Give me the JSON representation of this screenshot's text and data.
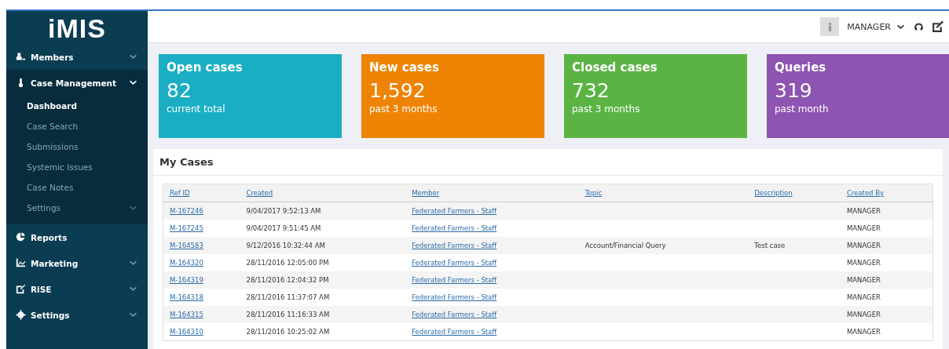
{
  "sidebar": {
    "logo": "iMIS",
    "items": [
      {
        "label": "Members",
        "kind": "group",
        "expanded": false
      },
      {
        "label": "Case Management",
        "kind": "group",
        "expanded": true,
        "children": [
          {
            "label": "Dashboard",
            "kind": "link",
            "selected": true
          },
          {
            "label": "Case Search",
            "kind": "link",
            "selected": false
          },
          {
            "label": "Submissions",
            "kind": "link",
            "selected": false
          },
          {
            "label": "Systemic Issues",
            "kind": "link",
            "selected": false
          },
          {
            "label": "Case Notes",
            "kind": "link",
            "selected": false
          },
          {
            "label": "Settings",
            "kind": "group",
            "selected": false
          }
        ]
      },
      {
        "label": "Reports",
        "kind": "link",
        "expanded": false
      },
      {
        "label": "Marketing",
        "kind": "group",
        "expanded": false
      },
      {
        "label": "RiSE",
        "kind": "group",
        "expanded": false
      },
      {
        "label": "Settings",
        "kind": "group",
        "expanded": false
      }
    ]
  },
  "topbar": {
    "user": "MANAGER"
  },
  "cards": [
    {
      "title": "Open cases",
      "value": "82",
      "note": "current total",
      "color": "#1aaec4"
    },
    {
      "title": "New cases",
      "value": "1,592",
      "note": "past 3 months",
      "color": "#ef8404"
    },
    {
      "title": "Closed cases",
      "value": "732",
      "note": "past 3 months",
      "color": "#5bb344"
    },
    {
      "title": "Queries",
      "value": "319",
      "note": "past month",
      "color": "#8e54b2"
    }
  ],
  "my_cases": {
    "title": "My Cases",
    "columns": [
      "Ref ID",
      "Created",
      "Member",
      "Topic",
      "Description",
      "Created By"
    ],
    "rows": [
      [
        "M-167246",
        "9/04/2017 9:52:13 AM",
        "Federated Farmers - Staff",
        "",
        "",
        "MANAGER"
      ],
      [
        "M-167245",
        "9/04/2017 9:51:45 AM",
        "Federated Farmers - Staff",
        "",
        "",
        "MANAGER"
      ],
      [
        "M-164583",
        "9/12/2016 10:32:44 AM",
        "Federated Farmers - Staff",
        "Account/Financial Query",
        "Test case",
        "MANAGER"
      ],
      [
        "M-164320",
        "28/11/2016 12:05:00 PM",
        "Federated Farmers - Staff",
        "",
        "",
        "MANAGER"
      ],
      [
        "M-164319",
        "28/11/2016 12:04:32 PM",
        "Federated Farmers - Staff",
        "",
        "",
        "MANAGER"
      ],
      [
        "M-164318",
        "28/11/2016 11:37:07 AM",
        "Federated Farmers - Staff",
        "",
        "",
        "MANAGER"
      ],
      [
        "M-164315",
        "28/11/2016 11:16:33 AM",
        "Federated Farmers - Staff",
        "",
        "",
        "MANAGER"
      ],
      [
        "M-164310",
        "28/11/2016 10:25:02 AM",
        "Federated Farmers - Staff",
        "",
        "",
        "MANAGER"
      ]
    ]
  }
}
